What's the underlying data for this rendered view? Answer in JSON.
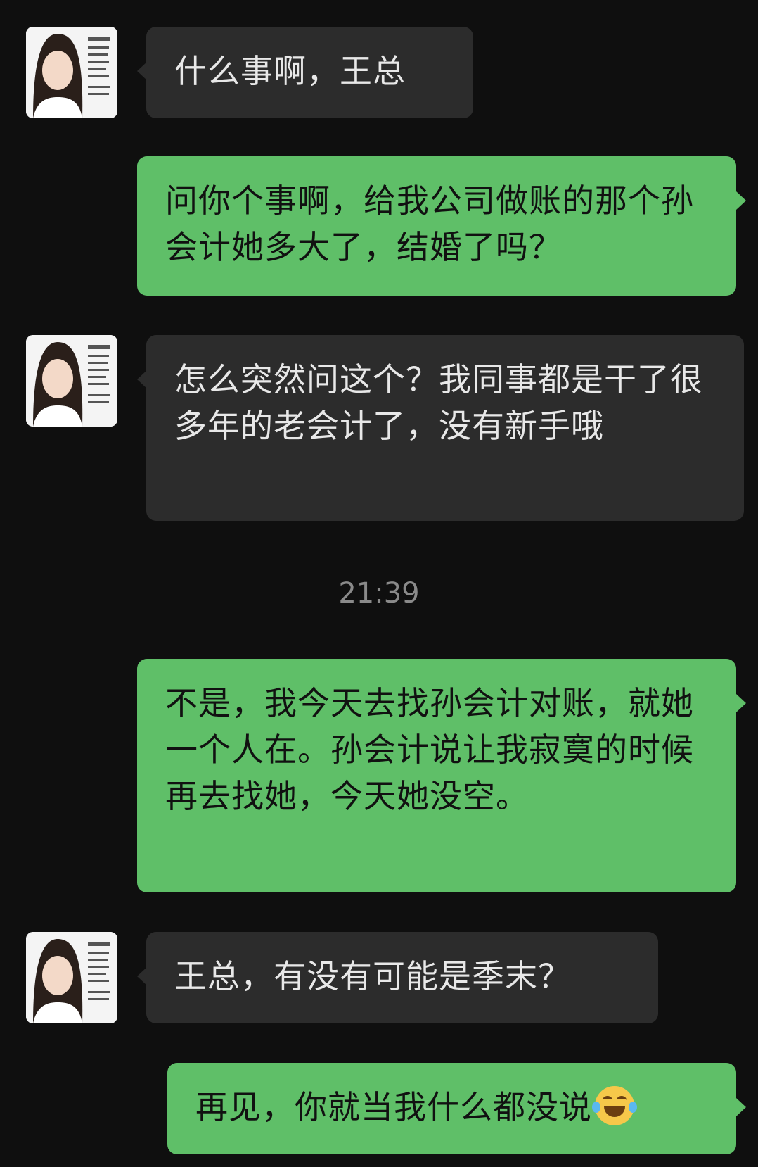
{
  "messages": [
    {
      "from": "other",
      "text": "什么事啊，王总"
    },
    {
      "from": "me",
      "text": "问你个事啊，给我公司做账的那个孙会计她多大了，结婚了吗？"
    },
    {
      "from": "other",
      "text": "怎么突然问这个？我同事都是干了很多年的老会计了，没有新手哦"
    },
    {
      "from": "me",
      "text": "不是，我今天去找孙会计对账，就她一个人在。孙会计说让我寂寞的时候再去找她，今天她没空。"
    },
    {
      "from": "other",
      "text": "王总，有没有可能是季末？"
    },
    {
      "from": "me",
      "text": "再见，你就当我什么都没说",
      "emoji": "laughing-crying-emoji"
    }
  ],
  "timestamp": "21:39",
  "colors": {
    "background": "#0f0f0f",
    "incoming_bubble": "#2c2c2c",
    "outgoing_bubble": "#5fbf68"
  }
}
